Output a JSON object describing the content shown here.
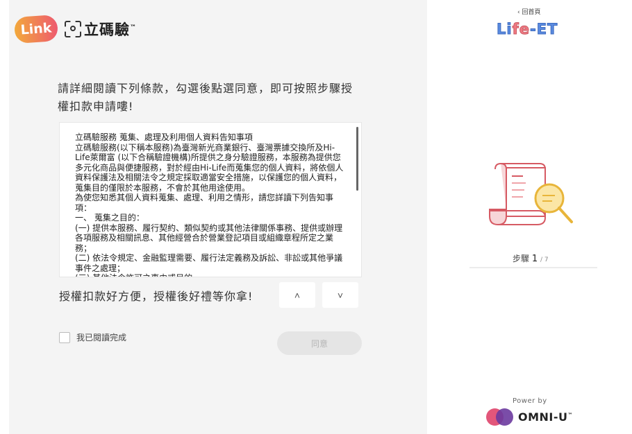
{
  "brand": {
    "link_logo": "Link",
    "name": "立碼驗",
    "tm": "™"
  },
  "intro": {
    "text": "請詳細閱讀下列條款，勾選後點選同意，即可按照步驟授權扣款申請嘍!"
  },
  "terms": {
    "content": "立碼驗服務 蒐集、處理及利用個人資料告知事項\n立碼驗服務(以下稱本服務)為臺灣新光商業銀行、臺灣票據交換所及Hi-Life萊爾富 (以下合稱驗證機構)所提供之身分驗證服務，本服務為提供您多元化商品與便捷服務，對於經由Hi-Life而蒐集您的個人資料，將依個人資料保護法及相關法令之規定採取適當安全措施，以保護您的個人資料，蒐集目的僅限於本服務，不會於其他用途使用。\n為使您知悉其個人資料蒐集、處理、利用之情形，請您詳讀下列告知事項：\n一、 蒐集之目的：\n(一) 提供本服務、履行契約、類似契約或其他法律關係事務、提供或辦理各項服務及相關訊息、其他經營合於營業登記項目或組織章程所定之業務；\n(二) 依法令規定、金融監理需要、履行法定義務及訴訟、非訟或其他爭議事件之處理；\n(三) 其他法令許可之事由或目的"
  },
  "slogan": {
    "text": "授權扣款好方便，授權後好禮等你拿!"
  },
  "nav": {
    "up": "˄",
    "down": "˅"
  },
  "agree": {
    "checkbox_label": "我已閱讀完成",
    "button_label": "同意"
  },
  "sidebar": {
    "back_label": "‹ 回首頁",
    "logo_part1": "Li",
    "logo_part2": "fe",
    "logo_part3": "-ET",
    "step_prefix": "步驟",
    "step_current": "1",
    "step_total": "/ 7",
    "power_by": "Power by",
    "omni_name": "OMNI-U",
    "omni_tm": "™"
  },
  "colors": {
    "accent_pink": "#ee5a6f",
    "accent_orange": "#f2a93b",
    "panel_bg": "#f4f4f4"
  }
}
